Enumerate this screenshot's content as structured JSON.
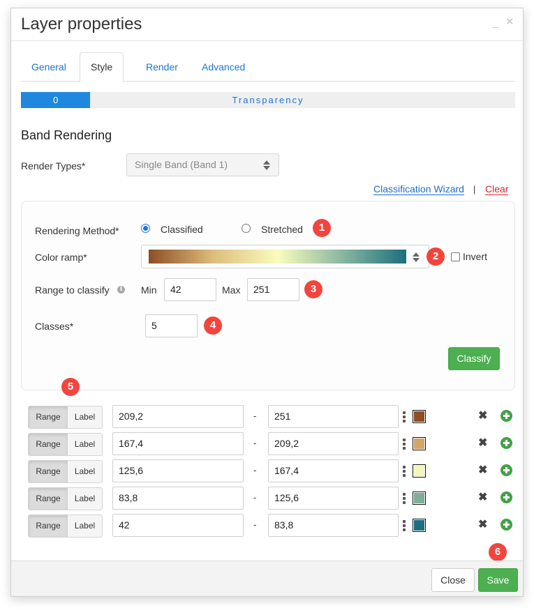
{
  "dialog": {
    "title": "Layer properties",
    "minimize_glyph": "_",
    "close_glyph": "✕"
  },
  "tabs": [
    {
      "label": "General",
      "active": false
    },
    {
      "label": "Style",
      "active": true
    },
    {
      "label": "Render",
      "active": false
    },
    {
      "label": "Advanced",
      "active": false
    }
  ],
  "transparency": {
    "value": "0",
    "label": "Transparency",
    "fill_fraction": 0.14
  },
  "band_rendering": {
    "title": "Band Rendering",
    "render_types_label": "Render Types*",
    "render_types_value": "Single Band (Band 1)",
    "classification_wizard_link": "Classification Wizard",
    "separator": "|",
    "clear_link": "Clear"
  },
  "classification": {
    "rendering_method_label": "Rendering Method*",
    "method_options": [
      {
        "label": "Classified",
        "selected": true
      },
      {
        "label": "Stretched",
        "selected": false
      }
    ],
    "color_ramp_label": "Color ramp*",
    "color_ramp_stops": [
      "#8c4e24",
      "#ddbd7c",
      "#fafcbe",
      "#8ab7a1",
      "#1d6f7d"
    ],
    "invert_label": "Invert",
    "invert_checked": false,
    "range_label": "Range to classify",
    "min_label": "Min",
    "min_value": "42",
    "max_label": "Max",
    "max_value": "251",
    "classes_label": "Classes*",
    "classes_value": "5",
    "classify_button": "Classify"
  },
  "badges": [
    "1",
    "2",
    "3",
    "4",
    "5",
    "6"
  ],
  "class_rows": [
    {
      "toggle_range": "Range",
      "toggle_label": "Label",
      "from": "209,2",
      "dash": "-",
      "to": "251",
      "color": "#8f4e23"
    },
    {
      "toggle_range": "Range",
      "toggle_label": "Label",
      "from": "167,4",
      "dash": "-",
      "to": "209,2",
      "color": "#d2a66a"
    },
    {
      "toggle_range": "Range",
      "toggle_label": "Label",
      "from": "125,6",
      "dash": "-",
      "to": "167,4",
      "color": "#f3f7bb"
    },
    {
      "toggle_range": "Range",
      "toggle_label": "Label",
      "from": "83,8",
      "dash": "-",
      "to": "125,6",
      "color": "#7fae9b"
    },
    {
      "toggle_range": "Range",
      "toggle_label": "Label",
      "from": "42",
      "dash": "-",
      "to": "83,8",
      "color": "#1e6f7e"
    }
  ],
  "icons": {
    "delete": "✖"
  },
  "footer": {
    "close_button": "Close",
    "save_button": "Save"
  }
}
